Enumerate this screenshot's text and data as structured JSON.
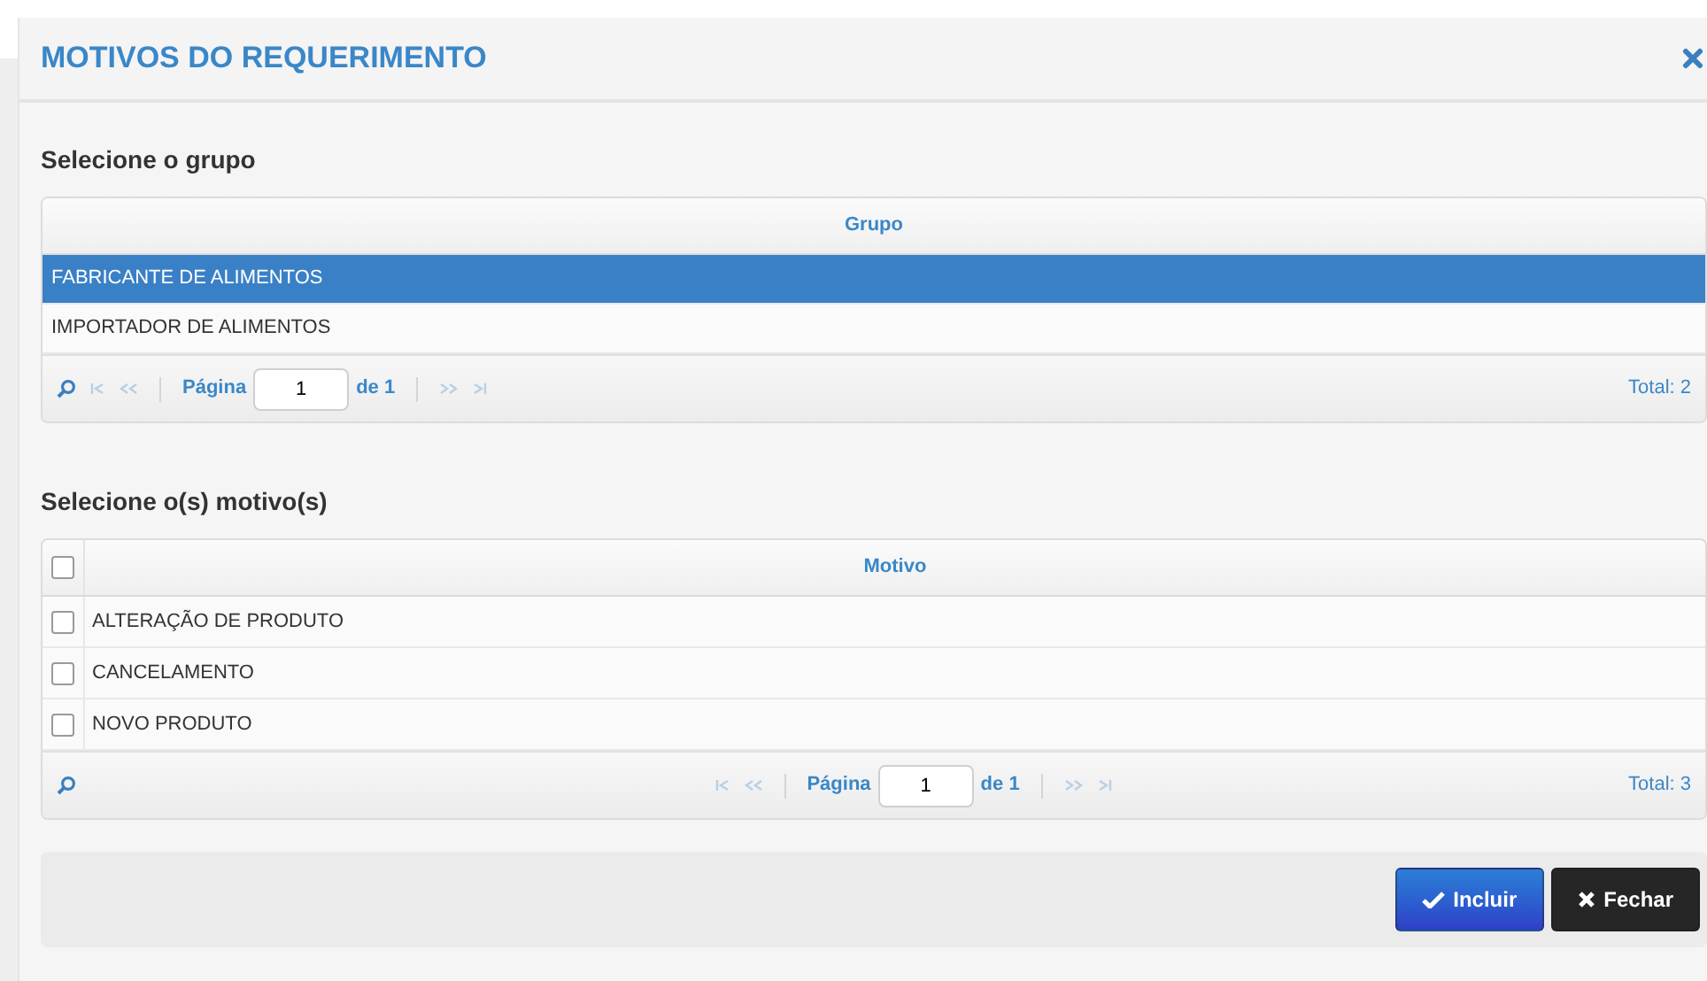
{
  "dialog": {
    "title": "MOTIVOS DO REQUERIMENTO"
  },
  "group_section": {
    "heading": "Selecione o grupo",
    "column": "Grupo",
    "rows": [
      {
        "label": "FABRICANTE DE ALIMENTOS",
        "selected": true
      },
      {
        "label": "IMPORTADOR DE ALIMENTOS",
        "selected": false
      }
    ],
    "pager": {
      "page_label": "Página",
      "page": "1",
      "of": "de 1",
      "total": "Total: 2"
    }
  },
  "reason_section": {
    "heading": "Selecione o(s) motivo(s)",
    "column": "Motivo",
    "select_all_checked": false,
    "rows": [
      {
        "label": "ALTERAÇÃO DE PRODUTO",
        "checked": false
      },
      {
        "label": "CANCELAMENTO",
        "checked": false
      },
      {
        "label": "NOVO PRODUTO",
        "checked": false
      }
    ],
    "pager": {
      "page_label": "Página",
      "page": "1",
      "of": "de 1",
      "total": "Total: 3"
    }
  },
  "buttons": [
    {
      "label": "Incluir",
      "kind": "confirm"
    },
    {
      "label": "Fechar",
      "kind": "close"
    }
  ]
}
